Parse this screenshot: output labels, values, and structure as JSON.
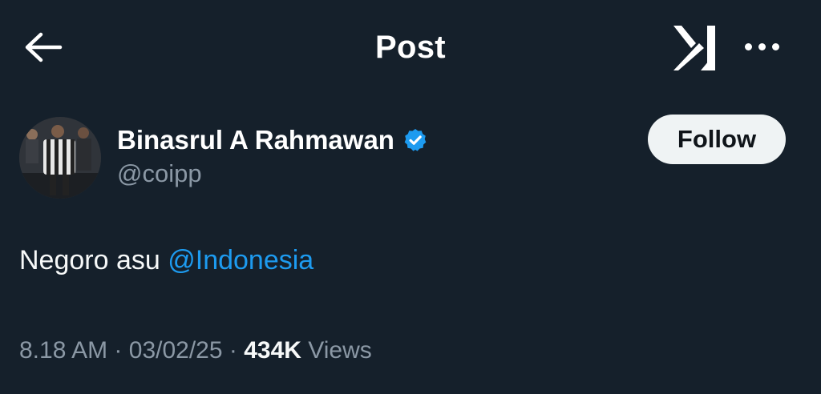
{
  "header": {
    "title": "Post",
    "back_icon": "arrow-left-icon",
    "grok_icon": "grok-logo-icon",
    "more_icon": "more-horizontal-icon"
  },
  "author": {
    "name": "Binasrul A Rahmawan",
    "handle": "@coipp",
    "verified": true,
    "verified_color": "#1d9bf0"
  },
  "follow": {
    "label": "Follow"
  },
  "post": {
    "text": "Negoro asu",
    "mention": "@Indonesia"
  },
  "meta": {
    "time": "8.18 AM",
    "date": "03/02/25",
    "separator": "·",
    "views_count": "434K",
    "views_label": "Views"
  },
  "colors": {
    "background": "#15202b",
    "text": "#ffffff",
    "secondary": "#8b98a5",
    "link": "#1d9bf0",
    "follow_bg": "#eff3f4"
  }
}
